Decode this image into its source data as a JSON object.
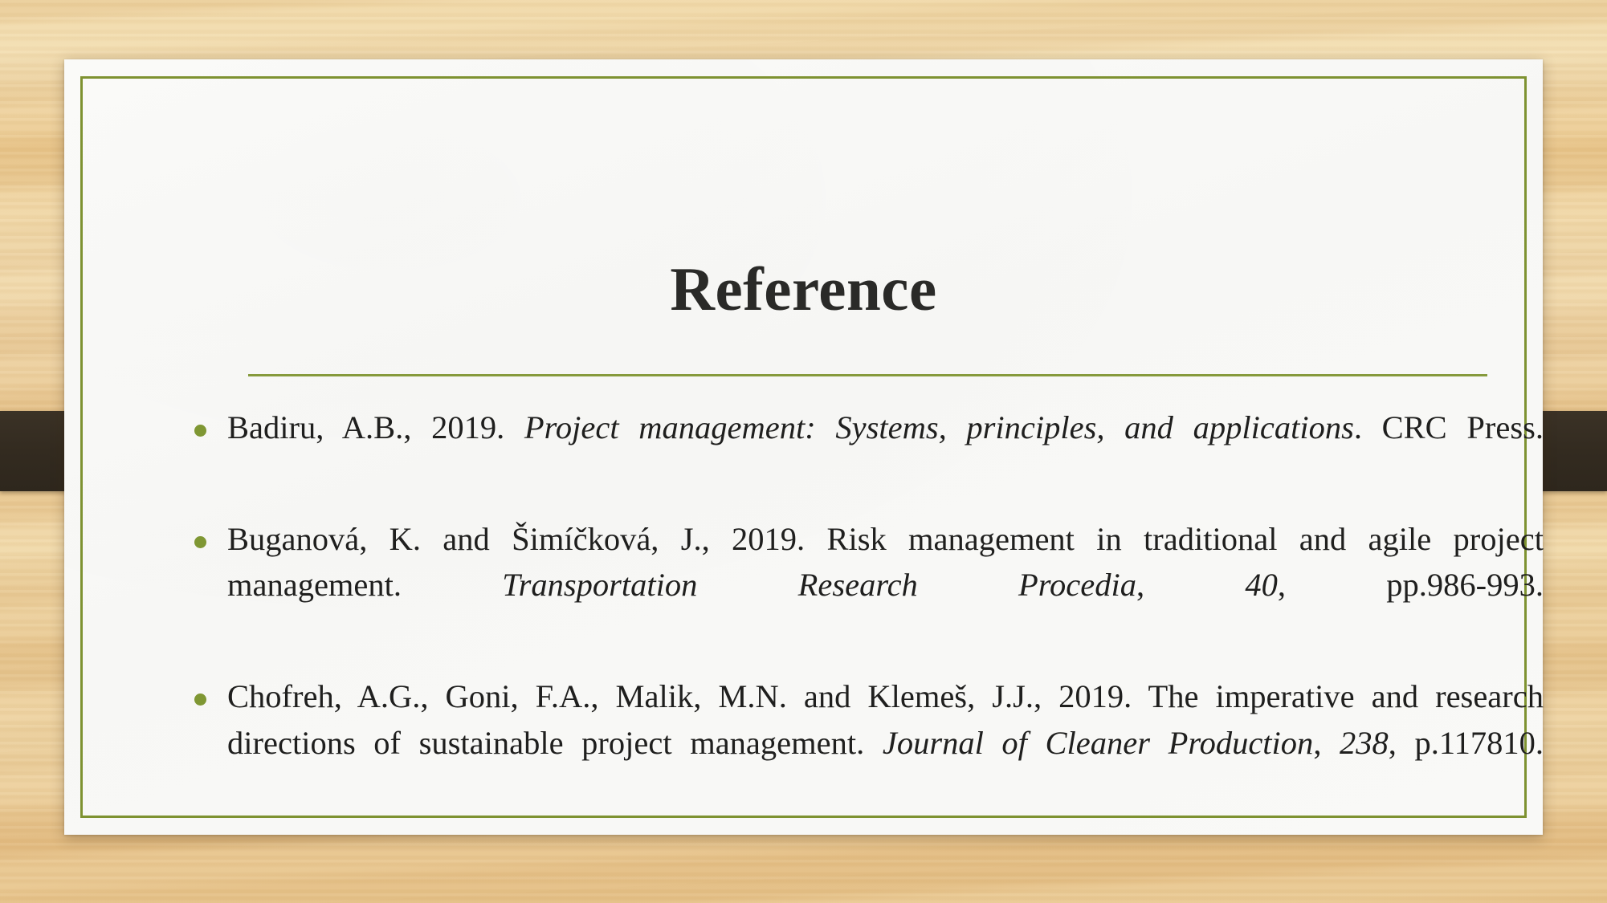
{
  "slide": {
    "title": "Reference",
    "theme": {
      "background_color": "#e9c68d",
      "card_color": "#f9f9f7",
      "accent_color": "#7e9231",
      "rule_color": "#869a3c",
      "bullet_color": "#7f9733",
      "title_color": "#2a2a28",
      "text_color": "#1f1f1e",
      "ribbon_color": "#332b20",
      "stud_color": "#a98b52"
    },
    "references": [
      {
        "authors": "Badiru, A.B., 2019.",
        "title": "Project management: Systems, principles, and applications",
        "source": "CRC Press.",
        "html": "Badiru, A.B., 2019. <i>Project management: Systems, principles, and applications</i>. CRC Press."
      },
      {
        "authors": "Buganová, K. and Šimíčková, J., 2019.",
        "title": "Risk management in traditional and agile project management.",
        "journal": "Transportation Research Procedia",
        "volume": "40",
        "pages": "pp.986-993.",
        "html": "Buganová, K. and Šimíčková, J., 2019. Risk management in traditional and agile project management. <i>Transportation Research Procedia</i>, <i>40</i>, pp.986-993."
      },
      {
        "authors": "Chofreh, A.G., Goni, F.A., Malik, M.N. and Klemeš, J.J., 2019.",
        "title": "The imperative and research directions of sustainable project management.",
        "journal": "Journal of Cleaner Production",
        "volume": "238",
        "pages": "p.117810.",
        "html": "Chofreh, A.G., Goni, F.A., Malik, M.N. and Klemeš, J.J., 2019. The imperative and research directions of sustainable project management. <i>Journal of Cleaner Production</i>, <i>238</i>, p.117810."
      }
    ]
  }
}
